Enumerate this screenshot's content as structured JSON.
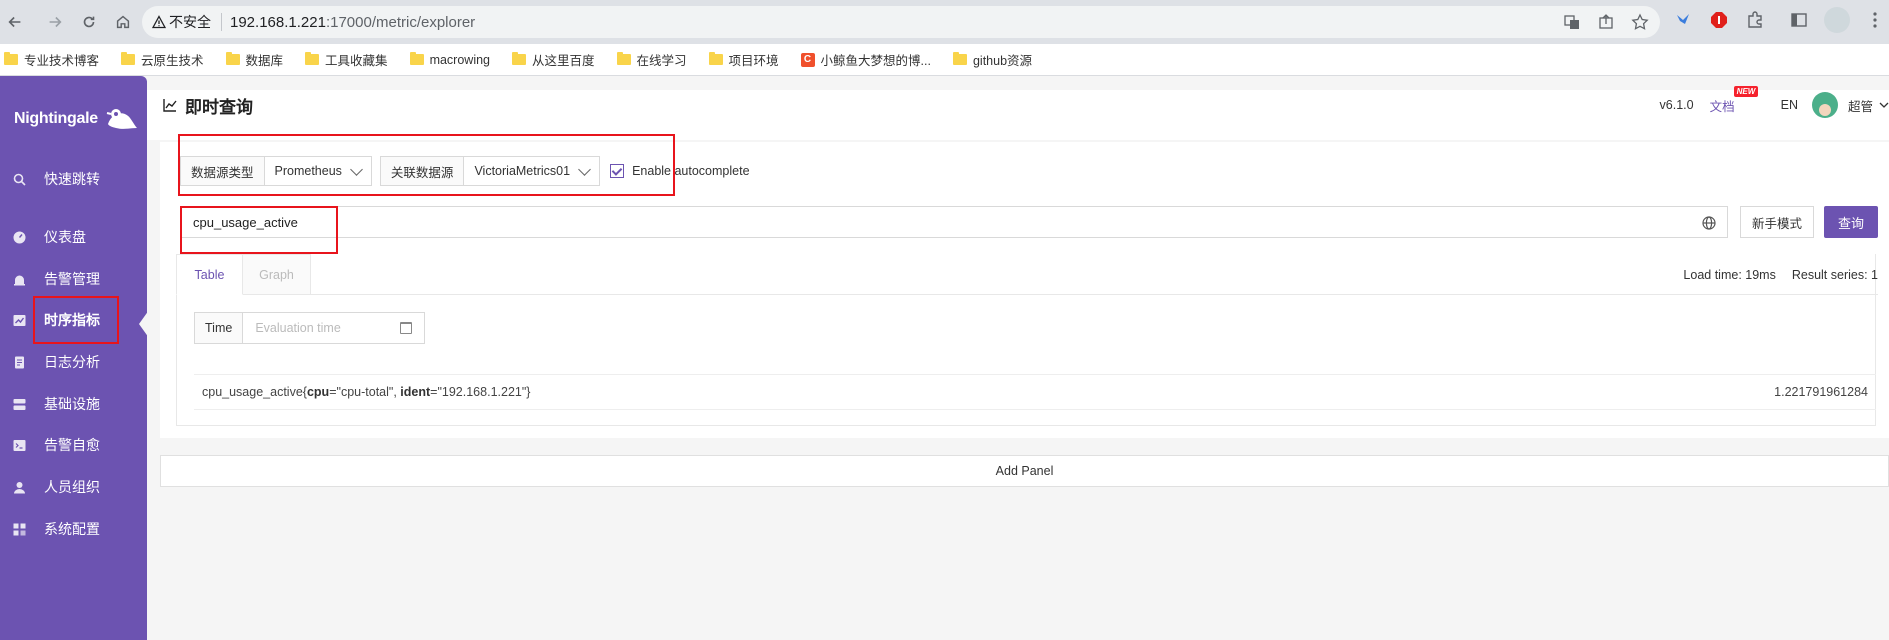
{
  "browser": {
    "security_label": "不安全",
    "url_host": "192.168.1.221",
    "url_rest": ":17000/metric/explorer"
  },
  "bookmarks": [
    {
      "label": "专业技术博客",
      "icon": "folder-icon"
    },
    {
      "label": "云原生技术",
      "icon": "folder-icon"
    },
    {
      "label": "数据库",
      "icon": "folder-icon"
    },
    {
      "label": "工具收藏集",
      "icon": "folder-icon"
    },
    {
      "label": "macrowing",
      "icon": "folder-icon"
    },
    {
      "label": "从这里百度",
      "icon": "folder-icon"
    },
    {
      "label": "在线学习",
      "icon": "folder-icon"
    },
    {
      "label": "项目环境",
      "icon": "folder-icon"
    },
    {
      "label": "小鲸鱼大梦想的博...",
      "icon": "csdn-logo-icon",
      "logo_text": "C"
    },
    {
      "label": "github资源",
      "icon": "folder-icon"
    }
  ],
  "sidebar": {
    "brand": "Nightingale",
    "items": [
      {
        "label": "快速跳转",
        "icon": "search-icon"
      },
      {
        "label": "仪表盘",
        "icon": "dashboard-icon"
      },
      {
        "label": "告警管理",
        "icon": "alarm-icon"
      },
      {
        "label": "时序指标",
        "icon": "chart-icon",
        "active": true
      },
      {
        "label": "日志分析",
        "icon": "log-icon"
      },
      {
        "label": "基础设施",
        "icon": "server-icon"
      },
      {
        "label": "告警自愈",
        "icon": "terminal-icon"
      },
      {
        "label": "人员组织",
        "icon": "user-icon"
      },
      {
        "label": "系统配置",
        "icon": "settings-icon"
      }
    ]
  },
  "header": {
    "title": "即时查询",
    "version": "v6.1.0",
    "docs": "文档",
    "new_badge": "NEW",
    "lang": "EN",
    "user": "超管"
  },
  "query": {
    "ds_type_label": "数据源类型",
    "ds_type_value": "Prometheus",
    "linked_ds_label": "关联数据源",
    "linked_ds_value": "VictoriaMetrics01",
    "autocomplete_label": "Enable autocomplete",
    "autocomplete_checked": true,
    "promql": "cpu_usage_active",
    "novice_button": "新手模式",
    "query_button": "查询"
  },
  "tabs": {
    "items": [
      "Table",
      "Graph"
    ],
    "active": "Table",
    "load_time": "Load time: 19ms",
    "result_series": "Result series: 1"
  },
  "time_picker": {
    "label": "Time",
    "placeholder": "Evaluation time"
  },
  "results": [
    {
      "metric": "cpu_usage_active",
      "labels": [
        {
          "key": "cpu",
          "value": "\"cpu-total\""
        },
        {
          "key": "ident",
          "value": "\"192.168.1.221\""
        }
      ],
      "value": "1.221791961284"
    }
  ],
  "add_panel": "Add Panel",
  "colors": {
    "sidebar": "#6c53b1",
    "primary": "#6c53b1",
    "annotation": "#e8141c"
  }
}
